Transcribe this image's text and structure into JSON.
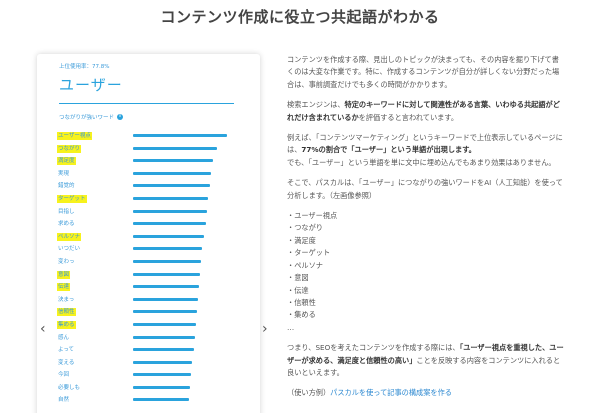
{
  "page": {
    "title": "コンテンツ作成に役立つ共起語がわかる"
  },
  "card": {
    "rate": "上位使用率：77.8%",
    "keyword": "ユーザー",
    "subhead": "つながりが強いワード",
    "info_icon": "info-icon",
    "words": [
      {
        "label": "ユーザー視点",
        "highlight": true,
        "strength": 0.84
      },
      {
        "label": "つながり",
        "highlight": true,
        "strength": 0.75
      },
      {
        "label": "満足度",
        "highlight": true,
        "strength": 0.71
      },
      {
        "label": "実現",
        "highlight": false,
        "strength": 0.7
      },
      {
        "label": "錯覚的",
        "highlight": false,
        "strength": 0.69
      },
      {
        "label": "ターゲット",
        "highlight": true,
        "strength": 0.67
      },
      {
        "label": "目指し",
        "highlight": false,
        "strength": 0.66
      },
      {
        "label": "求める",
        "highlight": false,
        "strength": 0.65
      },
      {
        "label": "ペルソナ",
        "highlight": true,
        "strength": 0.63
      },
      {
        "label": "いつだい",
        "highlight": false,
        "strength": 0.62
      },
      {
        "label": "変わっ",
        "highlight": false,
        "strength": 0.61
      },
      {
        "label": "意図",
        "highlight": true,
        "strength": 0.6
      },
      {
        "label": "伝達",
        "highlight": true,
        "strength": 0.59
      },
      {
        "label": "決まっ",
        "highlight": false,
        "strength": 0.58
      },
      {
        "label": "信頼性",
        "highlight": true,
        "strength": 0.57
      },
      {
        "label": "集める",
        "highlight": true,
        "strength": 0.56
      },
      {
        "label": "感ん",
        "highlight": false,
        "strength": 0.55
      },
      {
        "label": "よって",
        "highlight": false,
        "strength": 0.54
      },
      {
        "label": "変える",
        "highlight": false,
        "strength": 0.53
      },
      {
        "label": "今回",
        "highlight": false,
        "strength": 0.52
      },
      {
        "label": "必要しも",
        "highlight": false,
        "strength": 0.51
      },
      {
        "label": "自然",
        "highlight": false,
        "strength": 0.5
      }
    ]
  },
  "nav": {
    "prev": "‹",
    "next": "›"
  },
  "content": {
    "p1": "コンテンツを作成する際、見出しのトピックが決まっても、その内容を掘り下げて書くのは大変な作業です。特に、作成するコンテンツが自分が詳しくない分野だった場合は、事前調査だけでも多くの時間がかかります。",
    "p2_a": "検索エンジンは、",
    "p2_b": "特定のキーワードに対して関連性がある言葉、いわゆる共起語がどれだけ含まれているか",
    "p2_c": "を評価すると言われています。",
    "p3_a": "例えば、「コンテンツマーケティング」というキーワードで上位表示しているページには、",
    "p3_b": "77%の割合で「ユーザー」という単語が出現します。",
    "p3_c": "でも、「ユーザー」という単語を単に文中に埋め込んでもあまり効果はありません。",
    "p4": "そこで、パスカルは、「ユーザー」につながりの強いワードをAI（人工知能）を使って分析します。（左画像参照）",
    "list": [
      "・ユーザー視点",
      "・つながり",
      "・満足度",
      "・ターゲット",
      "・ペルソナ",
      "・意図",
      "・伝達",
      "・信頼性",
      "・集める",
      "…"
    ],
    "p5_a": "つまり、SEOを考えたコンテンツを作成する際には、",
    "p5_b": "「ユーザー視点を重視した、ユーザーが求める、満足度と信頼性の高い」",
    "p5_c": "ことを反映する内容をコンテンツに入れると良いといえます。",
    "usage_prefix": "（使い方例）",
    "usage_link": "パスカルを使って記事の構成案を作る"
  }
}
